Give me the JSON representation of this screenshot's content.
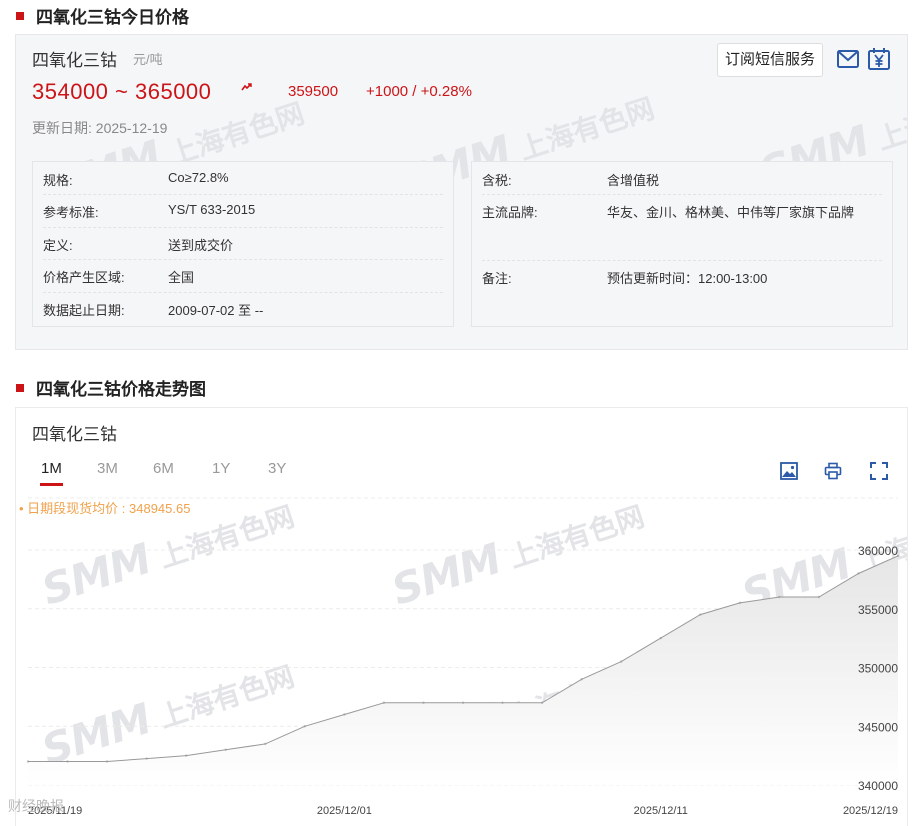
{
  "section1": {
    "title": "四氧化三钴今日价格"
  },
  "price": {
    "product": "四氧化三钴",
    "unit": "元/吨",
    "range": "354000 ~ 365000",
    "average": "359500",
    "change": "+1000 / +0.28%",
    "updated": "更新日期: 2025-12-19",
    "subscribe_label": "订阅短信服务",
    "icons": [
      "mail-icon",
      "yen-icon",
      "trend-up-icon"
    ]
  },
  "watermark": {
    "smm": "SMM",
    "cn": "上海有色网"
  },
  "specs_left": [
    {
      "k": "规格:",
      "v": "Co≥72.8%"
    },
    {
      "k": "参考标准:",
      "v": "YS/T 633-2015"
    },
    {
      "k": "定义:",
      "v": "送到成交价"
    },
    {
      "k": "价格产生区域:",
      "v": "全国"
    },
    {
      "k": "数据起止日期:",
      "v": "2009-07-02 至 --"
    }
  ],
  "specs_right": [
    {
      "k": "含税:",
      "v": "含增值税"
    },
    {
      "k": "主流品牌:",
      "v": "华友、金川、格林美、中伟等厂家旗下品牌"
    },
    {
      "k": "备注:",
      "v": "预估更新时间：12:00-13:00"
    }
  ],
  "section2": {
    "title": "四氧化三钴价格走势图"
  },
  "chart_panel": {
    "name": "四氧化三钴",
    "tabs": [
      "1M",
      "3M",
      "6M",
      "1Y",
      "3Y"
    ],
    "active_tab": "1M",
    "avg_note": "• 日期段现货均价 : 348945.65",
    "tools": [
      "image-icon",
      "print-icon",
      "fullscreen-icon"
    ]
  },
  "chart_data": {
    "type": "area",
    "ylim": [
      340000,
      360000
    ],
    "yticks": [
      340000,
      345000,
      350000,
      355000,
      360000
    ],
    "xticks": [
      "2025/11/19",
      "2025/12/01",
      "2025/12/11",
      "2025/12/19"
    ],
    "x": [
      "2025/11/19",
      "2025/11/20",
      "2025/11/21",
      "2025/11/24",
      "2025/11/25",
      "2025/11/26",
      "2025/11/27",
      "2025/11/28",
      "2025/12/01",
      "2025/12/02",
      "2025/12/03",
      "2025/12/04",
      "2025/12/05",
      "2025/12/08",
      "2025/12/09",
      "2025/12/10",
      "2025/12/11",
      "2025/12/12",
      "2025/12/15",
      "2025/12/16",
      "2025/12/17",
      "2025/12/18",
      "2025/12/19"
    ],
    "values": [
      342000,
      342000,
      342000,
      342250,
      342500,
      343000,
      343500,
      345000,
      346000,
      347000,
      347000,
      347000,
      347000,
      347000,
      349000,
      350500,
      352500,
      354500,
      355500,
      356000,
      356000,
      358000,
      359500
    ],
    "line_color": "#999999",
    "fill_color": "#e6e6e6",
    "grid": true
  },
  "footer": {
    "logo_text": "财经晚报"
  }
}
